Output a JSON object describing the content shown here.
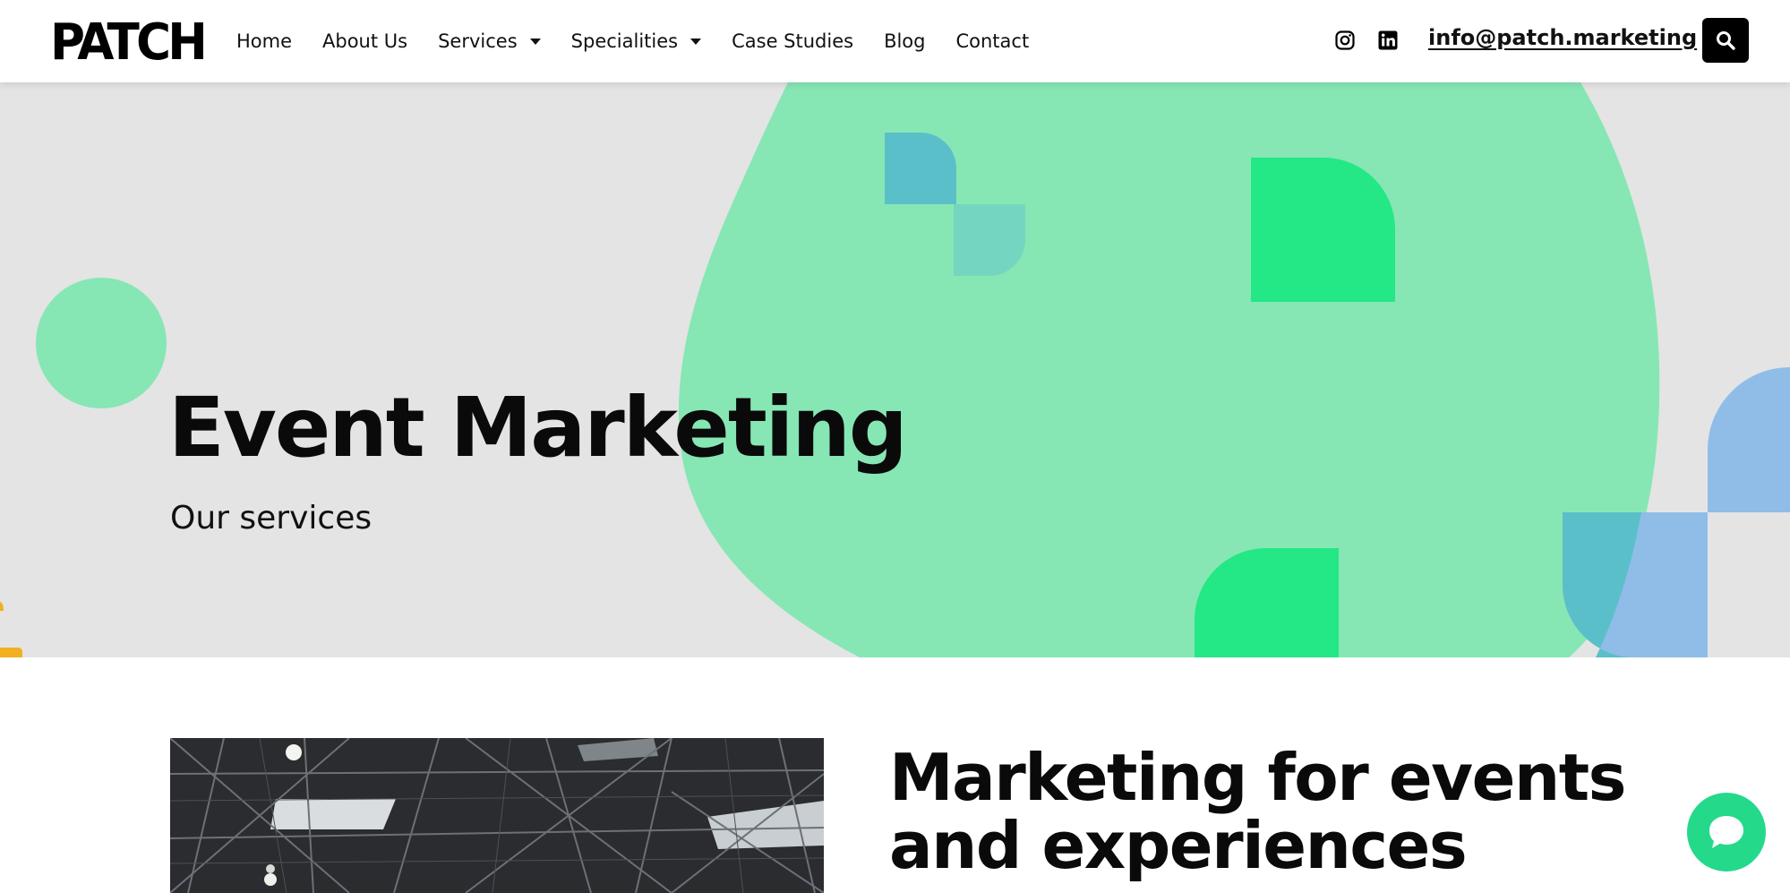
{
  "brand": {
    "logo_text": "PATCH"
  },
  "nav": {
    "items": [
      {
        "label": "Home",
        "dropdown": false
      },
      {
        "label": "About Us",
        "dropdown": false
      },
      {
        "label": "Services",
        "dropdown": true
      },
      {
        "label": "Specialities",
        "dropdown": true
      },
      {
        "label": "Case Studies",
        "dropdown": false
      },
      {
        "label": "Blog",
        "dropdown": false
      },
      {
        "label": "Contact",
        "dropdown": false
      }
    ]
  },
  "header_right": {
    "icons": [
      "instagram-icon",
      "linkedin-icon",
      "search-icon"
    ],
    "email": "info@patch.marketing"
  },
  "hero": {
    "title": "Event Marketing",
    "subtitle": "Our services"
  },
  "content": {
    "section_title_line1": "Marketing for events",
    "section_title_line2": "and experiences"
  },
  "chat": {
    "icon": "chat-bubble-icon"
  },
  "colors": {
    "mint": "#86e7b4",
    "green": "#23e885",
    "teal": "#5bbfc9",
    "blue": "#8fbde8",
    "yellow": "#f0b020",
    "hero_bg": "#e4e4e4",
    "chat": "#25d98b"
  }
}
